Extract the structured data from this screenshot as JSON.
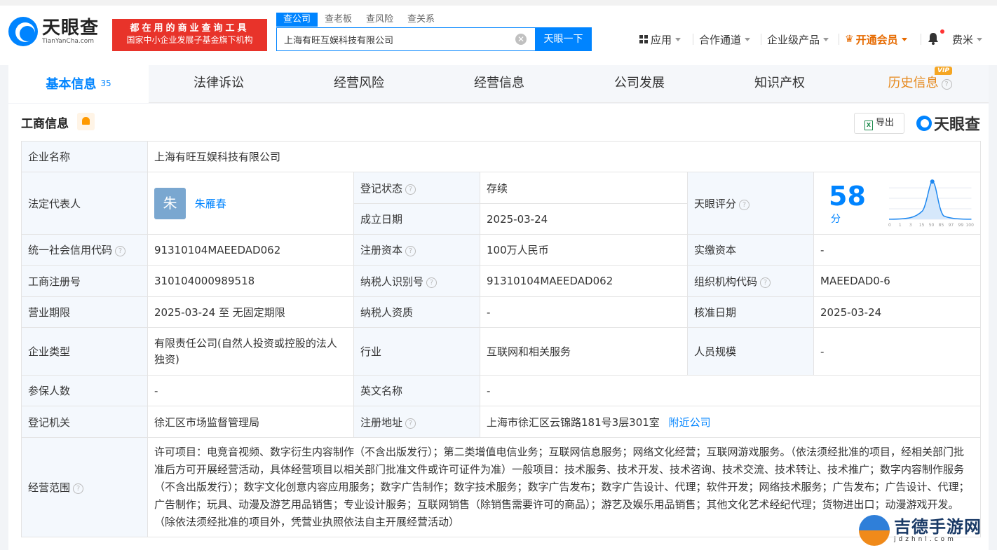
{
  "header": {
    "logo_cn": "天眼查",
    "logo_en": "TianYanCha.com",
    "slogan_1": "都在用的商业查询工具",
    "slogan_2": "国家中小企业发展子基金旗下机构",
    "search_tabs": [
      "查公司",
      "查老板",
      "查风险",
      "查关系"
    ],
    "search_value": "上海有旺互娱科技有限公司",
    "search_button": "天眼一下",
    "nav_apps": "应用",
    "nav_partner": "合作通道",
    "nav_enterprise": "企业级产品",
    "nav_vip": "开通会员",
    "user_name": "费米"
  },
  "tabs": {
    "basic": "基本信息",
    "basic_count": "35",
    "legal": "法律诉讼",
    "risk": "经营风险",
    "operation": "经营信息",
    "development": "公司发展",
    "ip": "知识产权",
    "history": "历史信息",
    "vip_badge": "VIP"
  },
  "section": {
    "title": "工商信息",
    "export": "导出",
    "brand": "天眼查"
  },
  "info": {
    "company_name_label": "企业名称",
    "company_name": "上海有旺互娱科技有限公司",
    "legal_rep_label": "法定代表人",
    "legal_rep_avatar": "朱",
    "legal_rep": "朱雁春",
    "reg_status_label": "登记状态",
    "reg_status": "存续",
    "est_date_label": "成立日期",
    "est_date": "2025-03-24",
    "score_label": "天眼评分",
    "score": "58",
    "score_unit": "分",
    "score_axis": [
      "0",
      "1",
      "3",
      "15",
      "50",
      "85",
      "97",
      "99",
      "100"
    ],
    "credit_code_label": "统一社会信用代码",
    "credit_code": "91310104MAEEDAD062",
    "reg_capital_label": "注册资本",
    "reg_capital": "100万人民币",
    "paid_capital_label": "实缴资本",
    "paid_capital": "-",
    "biz_reg_no_label": "工商注册号",
    "biz_reg_no": "310104000989518",
    "taxpayer_id_label": "纳税人识别号",
    "taxpayer_id": "91310104MAEEDAD062",
    "org_code_label": "组织机构代码",
    "org_code": "MAEEDAD0-6",
    "biz_term_label": "营业期限",
    "biz_term": "2025-03-24 至 无固定期限",
    "taxpayer_qual_label": "纳税人资质",
    "taxpayer_qual": "-",
    "approval_date_label": "核准日期",
    "approval_date": "2025-03-24",
    "company_type_label": "企业类型",
    "company_type": "有限责任公司(自然人投资或控股的法人独资)",
    "industry_label": "行业",
    "industry": "互联网和相关服务",
    "staff_size_label": "人员规模",
    "staff_size": "-",
    "insured_label": "参保人数",
    "insured": "-",
    "english_name_label": "英文名称",
    "english_name": "-",
    "reg_authority_label": "登记机关",
    "reg_authority": "徐汇区市场监督管理局",
    "reg_address_label": "注册地址",
    "reg_address": "上海市徐汇区云锦路181号3层301室",
    "nearby_link": "附近公司",
    "scope_label": "经营范围",
    "scope": "许可项目：电竞音视频、数字衍生内容制作（不含出版发行）；第二类增值电信业务；互联网信息服务；网络文化经营；互联网游戏服务。（依法须经批准的项目，经相关部门批准后方可开展经营活动，具体经营项目以相关部门批准文件或许可证件为准）一般项目：技术服务、技术开发、技术咨询、技术交流、技术转让、技术推广；数字内容制作服务（不含出版发行）；数字文化创意内容应用服务；数字广告制作；数字技术服务；数字广告发布；数字广告设计、代理；软件开发；网络技术服务；广告发布；广告设计、代理；广告制作；玩具、动漫及游艺用品销售；专业设计服务；互联网销售（除销售需要许可的商品）；游艺及娱乐用品销售；其他文化艺术经纪代理；货物进出口；动漫游戏开发。（除依法须经批准的项目外，凭营业执照依法自主开展经营活动）"
  },
  "watermark": {
    "cn": "吉德手游网",
    "en": "jdzhnl.com"
  }
}
